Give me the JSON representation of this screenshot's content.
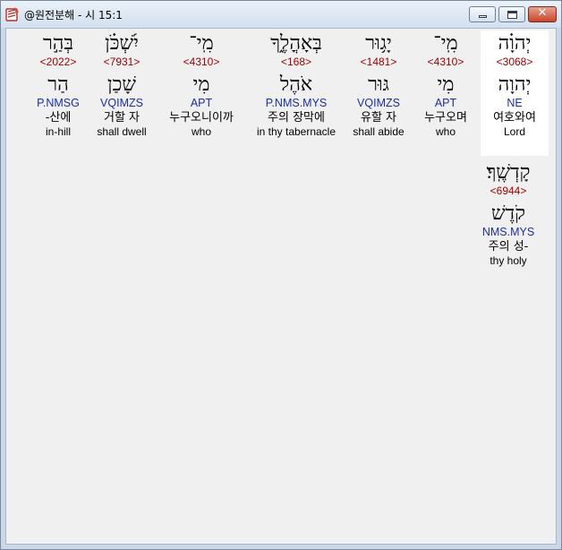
{
  "window": {
    "title": "@원전분해 - 시 15:1",
    "min_glyph": "–",
    "close_glyph": "✕"
  },
  "words": [
    {
      "word": "יְהוָ֗ה",
      "strong": "<3068>",
      "lemma": "יְהוָה",
      "parse": "NE",
      "korean": "여호와여",
      "english": "Lord"
    },
    {
      "word": "מִֽי־",
      "strong": "<4310>",
      "lemma": "מִי",
      "parse": "APT",
      "korean": "누구오며",
      "english": "who"
    },
    {
      "word": "יָג֥וּר",
      "strong": "<1481>",
      "lemma": "גּוּר",
      "parse": "VQIMZS",
      "korean": "유할 자",
      "english": "shall abide"
    },
    {
      "word": "בְּאָהֳלֶ֑ךָ",
      "strong": "<168>",
      "lemma": "אֹהֶל",
      "parse": "P.NMS.MYS",
      "korean": "주의 장막에",
      "english": "in thy tabernacle"
    },
    {
      "word": "מִֽי־",
      "strong": "<4310>",
      "lemma": "מִי",
      "parse": "APT",
      "korean": "누구오니이까",
      "english": "who"
    },
    {
      "word": "יִ֝שְׁכֹּ֗ן",
      "strong": "<7931>",
      "lemma": "שָׁכַן",
      "parse": "VQIMZS",
      "korean": "거할 자",
      "english": "shall dwell"
    },
    {
      "word": "בְּהַ֣ר",
      "strong": "<2022>",
      "lemma": "הַר",
      "parse": "P.NMSG",
      "korean": "-산에",
      "english": "in-hill"
    },
    {
      "word": "קָדְשֶֽׁךָ׃",
      "strong": "<6944>",
      "lemma": "קֹדֶשׁ",
      "parse": "NMS.MYS",
      "korean": "주의 성-",
      "english": "thy holy"
    }
  ],
  "colors": {
    "strong": "#a00000",
    "parse": "#1a2ea8",
    "selected_bg": "#ffffff",
    "client_bg": "#f0f0f0"
  }
}
